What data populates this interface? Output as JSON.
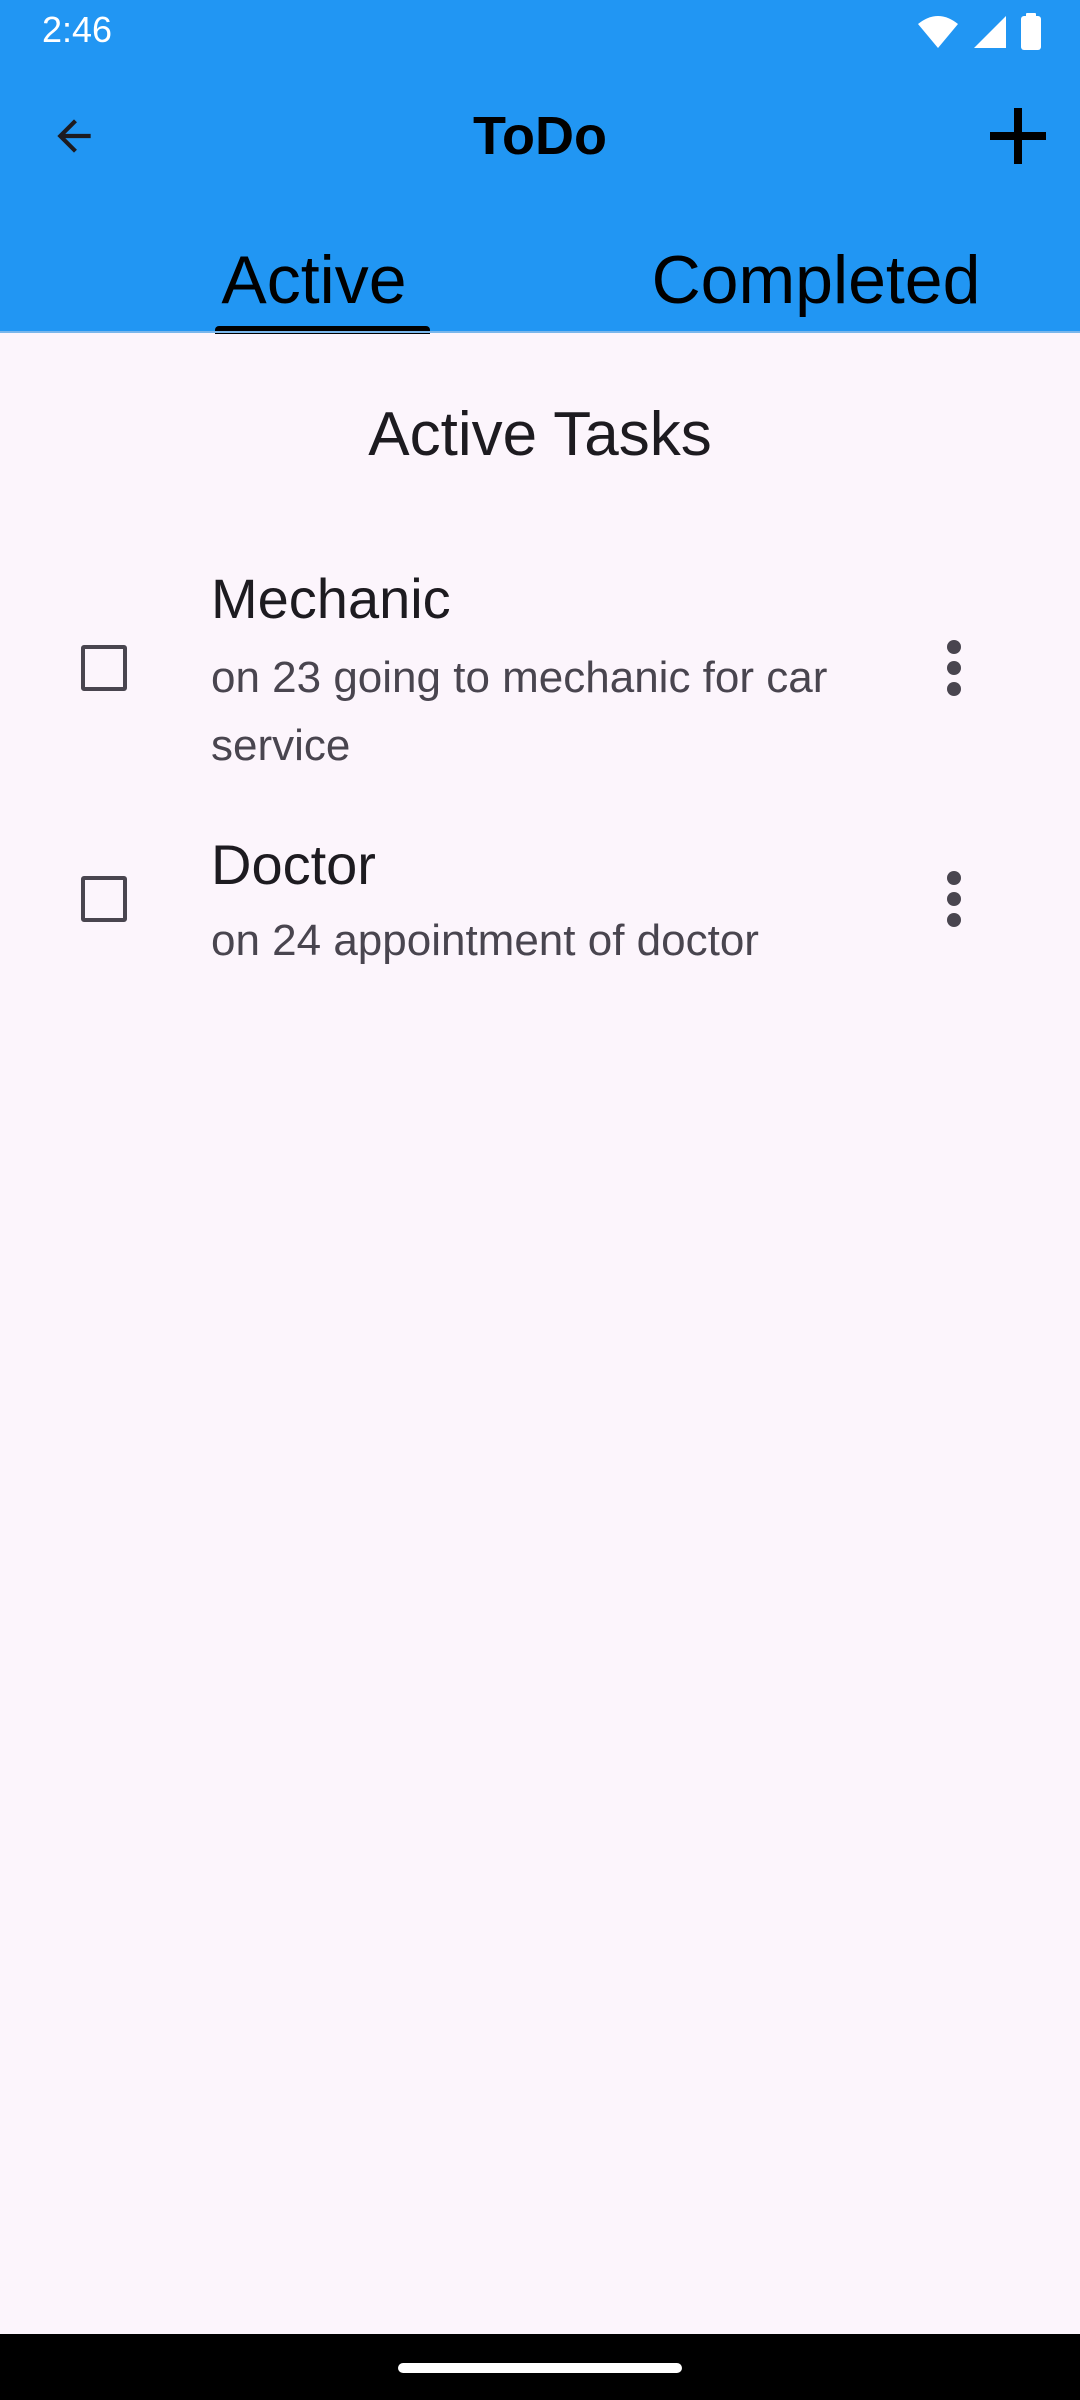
{
  "status_bar": {
    "time": "2:46",
    "icons": [
      "wifi-icon",
      "signal-icon",
      "battery-icon"
    ]
  },
  "toolbar": {
    "title": "ToDo",
    "back_icon": "arrow-back-icon",
    "add_icon": "plus-icon"
  },
  "tabs": [
    {
      "label": "Active",
      "selected": true
    },
    {
      "label": "Completed",
      "selected": false
    }
  ],
  "section": {
    "title": "Active Tasks"
  },
  "tasks": [
    {
      "title": "Mechanic",
      "description": "on 23 going to mechanic for car service",
      "checked": false
    },
    {
      "title": "Doctor",
      "description": "on 24 appointment of doctor",
      "checked": false
    }
  ],
  "colors": {
    "app_bar": "#2196f3",
    "background": "#fcf5fc",
    "text_primary": "#1d1b20",
    "text_secondary": "#49454f",
    "nav_bar": "#000000"
  }
}
